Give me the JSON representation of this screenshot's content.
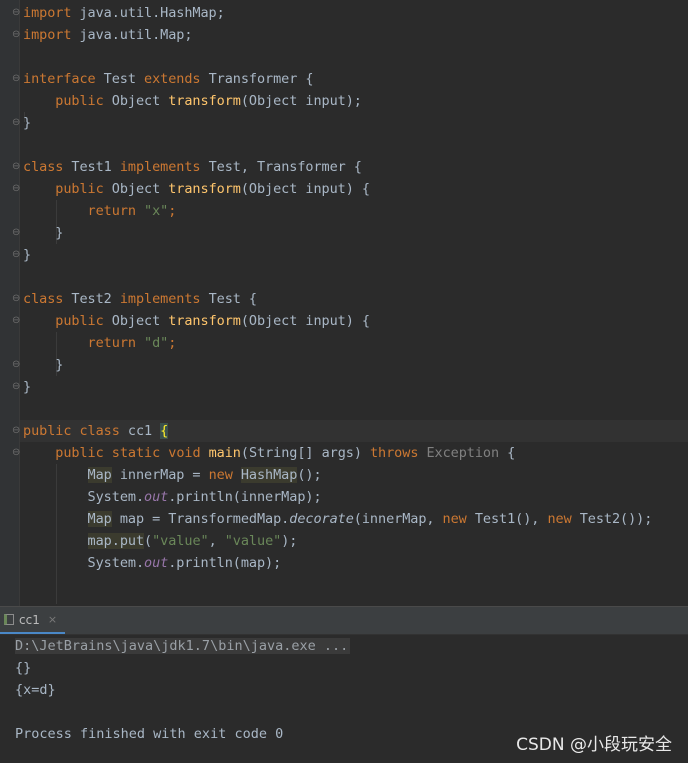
{
  "editor": {
    "lines": {
      "l1": {
        "kw": "import",
        "rest": " java.util.HashMap;"
      },
      "l2": {
        "kw": "import",
        "rest": " java.util.Map;"
      },
      "l4": {
        "kw1": "interface",
        "name": " Test ",
        "kw2": "extends",
        "rest": " Transformer {"
      },
      "l5": {
        "kw": "public",
        "type": " Object ",
        "fn": "transform",
        "rest": "(Object input);"
      },
      "l6": {
        "text": "}"
      },
      "l8": {
        "kw1": "class",
        "name": " Test1 ",
        "kw2": "implements",
        "rest": " Test, Transformer {"
      },
      "l9": {
        "kw": "public",
        "type": " Object ",
        "fn": "transform",
        "rest": "(Object input) {"
      },
      "l10": {
        "kw": "return",
        "str": "\"x\"",
        "end": ";"
      },
      "l11": {
        "text": "}"
      },
      "l12": {
        "text": "}"
      },
      "l14": {
        "kw1": "class",
        "name": " Test2 ",
        "kw2": "implements",
        "rest": " Test {"
      },
      "l15": {
        "kw": "public",
        "type": " Object ",
        "fn": "transform",
        "rest": "(Object input) {"
      },
      "l16": {
        "kw": "return",
        "str": "\"d\"",
        "end": ";"
      },
      "l17": {
        "text": "}"
      },
      "l18": {
        "text": "}"
      },
      "l20": {
        "kw1": "public",
        "kw2": "class",
        "name": " cc1 ",
        "brace": "{"
      },
      "l21": {
        "kw1": "public",
        "kw2": "static",
        "kw3": "void",
        "fn": "main",
        "args": "(String[] args) ",
        "kw4": "throws",
        "exc": " Exception",
        "end": " {"
      },
      "l22": {
        "type": "Map",
        "var": " innerMap = ",
        "kw": "new",
        "sp": " ",
        "cls": "HashMap",
        "end": "();"
      },
      "l23": {
        "pre": "System.",
        "field": "out",
        "post": ".println(innerMap);"
      },
      "l24": {
        "type": "Map",
        "var": " map = TransformedMap.",
        "method": "decorate",
        "args1": "(innerMap, ",
        "kw1": "new",
        "t1": " Test1(), ",
        "kw2": "new",
        "t2": " Test2());"
      },
      "l25": {
        "call": "map.put",
        "open": "(",
        "s1": "\"value\"",
        "comma": ", ",
        "s2": "\"value\"",
        "end": ");"
      },
      "l26": {
        "pre": "System.",
        "field": "out",
        "post": ".println(map);"
      }
    }
  },
  "run": {
    "tab_label": "cc1",
    "close_glyph": "×",
    "command": "D:\\JetBrains\\java\\jdk1.7\\bin\\java.exe ...",
    "output": [
      "{}",
      "{x=d}",
      "",
      "Process finished with exit code 0"
    ]
  },
  "watermark": "CSDN @小段玩安全",
  "colors": {
    "background": "#2b2b2b",
    "keyword": "#cc7832",
    "method": "#ffc66d",
    "string": "#6a8759",
    "field": "#9876aa",
    "text": "#a9b7c6"
  }
}
